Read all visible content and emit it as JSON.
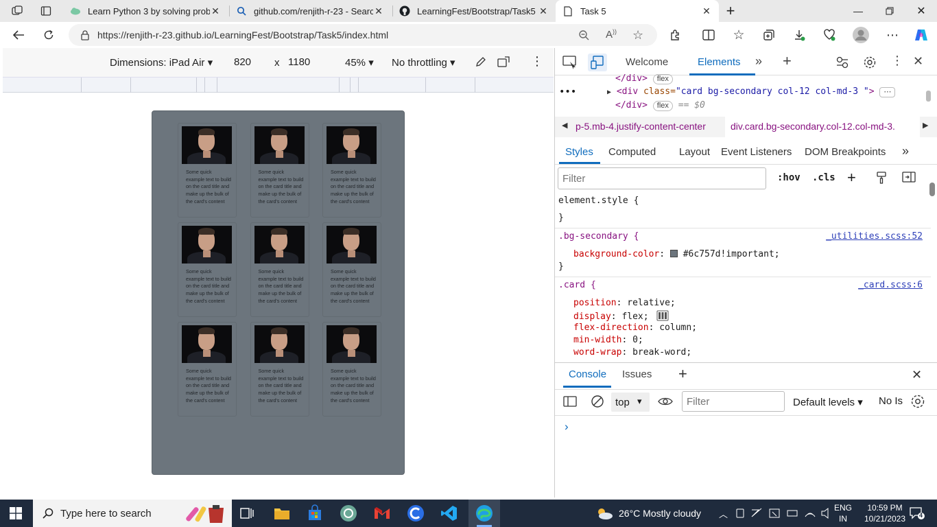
{
  "browser": {
    "tabs": [
      {
        "label": "Learn Python 3 by solving proble",
        "icon": "cloud-icon"
      },
      {
        "label": "github.com/renjith-r-23 - Search",
        "icon": "search-icon"
      },
      {
        "label": "LearningFest/Bootstrap/Task5 at",
        "icon": "github-icon"
      },
      {
        "label": "Task 5",
        "icon": "page-icon"
      }
    ],
    "url": "https://renjith-r-23.github.io/LearningFest/Bootstrap/Task5/index.html"
  },
  "device_toolbar": {
    "dimensions": "Dimensions: iPad Air",
    "width": "820",
    "x": "x",
    "height": "1180",
    "zoom": "45%",
    "throttling": "No throttling"
  },
  "page": {
    "card_text": "Some quick example text to build on the card title and make up the bulk of the card's content",
    "card_count": 9,
    "background": "#6c757d"
  },
  "devtools": {
    "tabs": [
      "Welcome",
      "Elements"
    ],
    "dom": {
      "line1_tag": "</div>",
      "line1_pill": "flex",
      "line2_open": "<div",
      "line2_attr": "class=",
      "line2_val": "\"card bg-secondary col-12 col-md-3 \"",
      "line2_close": ">",
      "line3_tag": "</div>",
      "line3_pill": "flex",
      "line3_eq": "== $0"
    },
    "breadcrumbs": [
      "p-5.mb-4.justify-content-center",
      "div.card.bg-secondary.col-12.col-md-3."
    ],
    "style_tabs": [
      "Styles",
      "Computed",
      "Layout",
      "Event Listeners",
      "DOM Breakpoints"
    ],
    "filter_placeholder": "Filter",
    "hov": ":hov",
    "cls": ".cls",
    "rules": {
      "element_style": "element.style {",
      "close": "}",
      "bg_selector": ".bg-secondary {",
      "bg_source": "_utilities.scss:52",
      "bg_prop": "background-color",
      "bg_value": "#6c757d!important;",
      "card_selector": ".card {",
      "card_source": "_card.scss:6",
      "card_props": [
        {
          "name": "position",
          "value": "relative;"
        },
        {
          "name": "display",
          "value": "flex;"
        },
        {
          "name": "flex-direction",
          "value": "column;"
        },
        {
          "name": "min-width",
          "value": "0;"
        },
        {
          "name": "word-wrap",
          "value": "break-word;"
        }
      ]
    },
    "console": {
      "tabs": [
        "Console",
        "Issues"
      ],
      "context": "top",
      "filter_placeholder": "Filter",
      "levels": "Default levels",
      "no_issues": "No Is"
    }
  },
  "taskbar": {
    "search_placeholder": "Type here to search",
    "weather": "26°C  Mostly cloudy",
    "lang1": "ENG",
    "lang2": "IN",
    "time": "10:59 PM",
    "date": "10/21/2023",
    "notification_count": "4"
  },
  "colors": {
    "accent": "#0f6cbd",
    "swatch": "#6c757d"
  }
}
